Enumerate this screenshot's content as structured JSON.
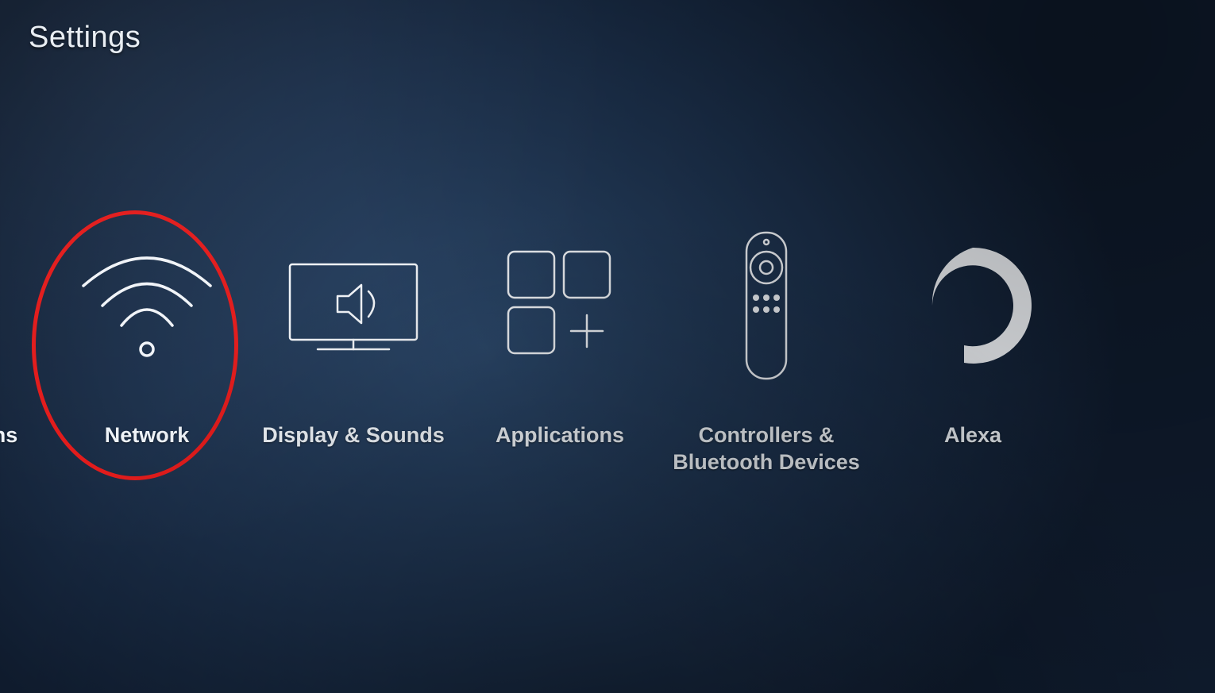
{
  "header": {
    "title": "Settings"
  },
  "items": [
    {
      "id": "notifications",
      "label": "tions",
      "partial": true
    },
    {
      "id": "network",
      "label": "Network",
      "highlighted": true
    },
    {
      "id": "display",
      "label": "Display & Sounds"
    },
    {
      "id": "applications",
      "label": "Applications"
    },
    {
      "id": "controllers",
      "label": "Controllers &\nBluetooth Devices"
    },
    {
      "id": "alexa",
      "label": "Alexa"
    }
  ],
  "annotation": {
    "target": "network",
    "color": "#e21a1a"
  }
}
